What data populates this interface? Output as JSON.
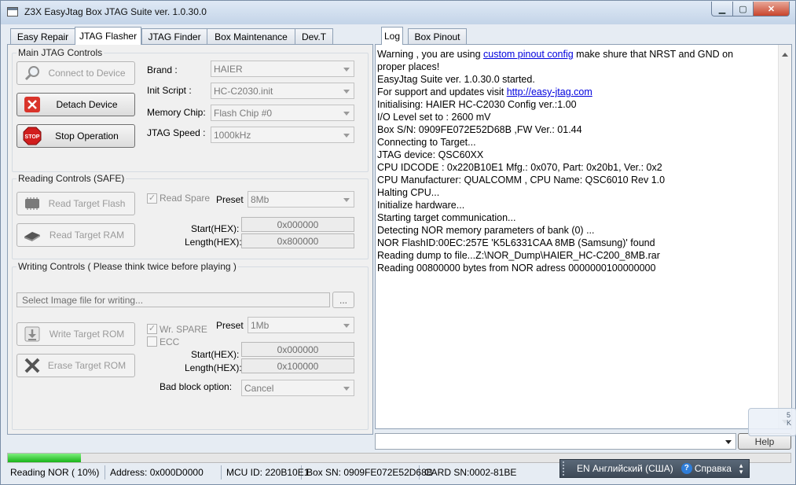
{
  "window": {
    "title": "Z3X EasyJtag Box JTAG Suite ver. 1.0.30.0"
  },
  "left_tabs": [
    "Easy Repair",
    "JTAG Flasher",
    "JTAG Finder",
    "Box Maintenance",
    "Dev.T"
  ],
  "main_controls": {
    "title": "Main JTAG Controls",
    "connect": "Connect to Device",
    "detach": "Detach Device",
    "stop": "Stop Operation",
    "brand_label": "Brand :",
    "brand_value": "HAIER",
    "init_label": "Init Script :",
    "init_value": "HC-C2030.init",
    "chip_label": "Memory Chip:",
    "chip_value": "Flash Chip #0",
    "speed_label": "JTAG Speed :",
    "speed_value": "1000kHz"
  },
  "reading": {
    "title": "Reading Controls (SAFE)",
    "read_flash": "Read Target Flash",
    "read_ram": "Read Target RAM",
    "read_spare": "Read Spare",
    "preset_label": "Preset",
    "preset_value": "8Mb",
    "start_label": "Start(HEX):",
    "start_value": "0x000000",
    "length_label": "Length(HEX):",
    "length_value": "0x800000"
  },
  "writing": {
    "title": "Writing Controls ( Please think twice before playing )",
    "file_placeholder": "Select Image file for writing...",
    "browse": "...",
    "write_rom": "Write Target ROM",
    "erase_rom": "Erase Target ROM",
    "wr_spare": "Wr. SPARE",
    "ecc": "ECC",
    "preset_label": "Preset",
    "preset_value": "1Mb",
    "start_label": "Start(HEX):",
    "start_value": "0x000000",
    "length_label": "Length(HEX):",
    "length_value": "0x100000",
    "bad_block_label": "Bad block option:",
    "bad_block_value": "Cancel"
  },
  "right_tabs": [
    "Log",
    "Box Pinout"
  ],
  "log": {
    "l1a": "Warning , you are using ",
    "l1link": "custom pinout config",
    "l1b": " make shure that NRST and GND on",
    "l2": "proper places!",
    "l3": "EasyJtag Suite ver.  1.0.30.0 started.",
    "l4a": "For support and updates visit ",
    "l4link": "http://easy-jtag.com",
    "lines": [
      "Initialising: HAIER HC-C2030 Config ver.:1.00",
      "I/O Level set to : 2600 mV",
      "Box S/N: 0909FE072E52D68B ,FW Ver.: 01.44",
      "Connecting to Target...",
      "JTAG device: QSC60XX",
      "CPU IDCODE : 0x220B10E1 Mfg.: 0x070, Part: 0x20b1, Ver.: 0x2",
      "CPU Manufacturer: QUALCOMM , CPU Name: QSC6010 Rev 1.0",
      "Halting CPU...",
      "Initialize hardware...",
      "Starting target communication...",
      "Detecting NOR memory parameters of bank (0) ...",
      "NOR FlashID:00EC:257E 'K5L6331CAA 8MB (Samsung)' found",
      "Reading dump to file...Z:\\NOR_Dump\\HAIER_HC-C200_8MB.rar",
      "Reading 00800000 bytes from NOR adress 0000000100000000"
    ]
  },
  "help_button": "Help",
  "progress": {
    "fraction": 0.093
  },
  "status": {
    "reading": "Reading NOR ( 10%)",
    "address": "Address: 0x000D0000",
    "mcu": "MCU ID: 220B10E1",
    "box_sn": "Box SN: 0909FE072E52D68B",
    "card_sn": "CARD SN:0002-81BE"
  },
  "langbar": {
    "lang": "EN Английский (США)",
    "help": "Справка"
  },
  "notification": {
    "text": "5 K"
  },
  "colors": {
    "progress": "#22c022",
    "link": "#0000dd",
    "close": "#c8442c"
  }
}
